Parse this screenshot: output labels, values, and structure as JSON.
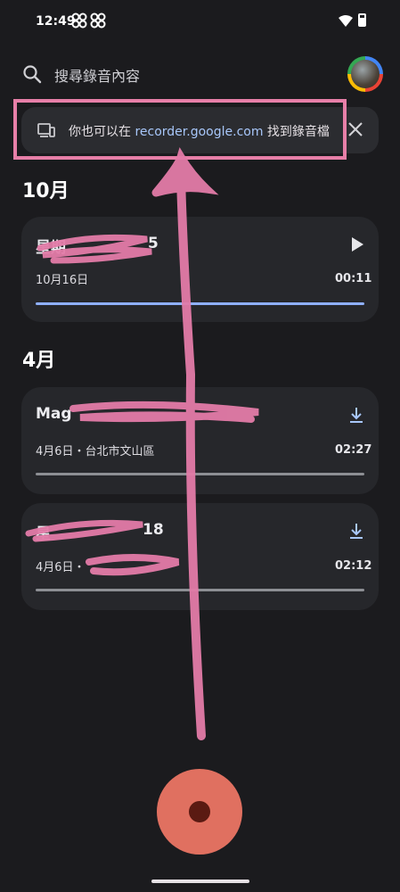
{
  "status_bar": {
    "time": "12:49"
  },
  "search": {
    "placeholder": "搜尋錄音內容"
  },
  "banner": {
    "text_before": "你也可以在 ",
    "link": "recorder.google.com",
    "text_after": " 找到錄音檔"
  },
  "sections": [
    {
      "month": "10月",
      "recordings": [
        {
          "title": "星期",
          "title_tail": "5",
          "meta": "10月16日",
          "duration": "00:11",
          "action_icon": "play-icon"
        }
      ]
    },
    {
      "month": "4月",
      "recordings": [
        {
          "title": "Mag",
          "title_tail": "",
          "meta": "4月6日・台北市文山區",
          "duration": "02:27",
          "action_icon": "download-icon"
        },
        {
          "title": "星",
          "title_tail": "18",
          "meta": "4月6日・",
          "duration": "02:12",
          "action_icon": "download-icon"
        }
      ]
    }
  ],
  "colors": {
    "accent_pink": "#e77fa8",
    "link_blue": "#a8c7fa",
    "record_red": "#e07060",
    "progress_blue": "#8fb0ff"
  }
}
